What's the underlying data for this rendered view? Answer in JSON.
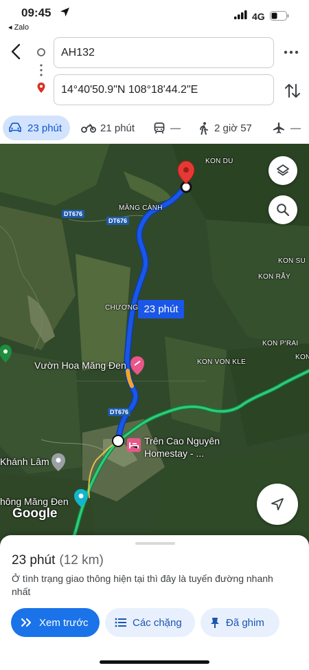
{
  "status_bar": {
    "time": "09:45",
    "back_app": "◂ Zalo",
    "network": "4G"
  },
  "directions": {
    "origin": "AH132",
    "destination": "14°40'50.9\"N 108°18'44.2\"E"
  },
  "modes": [
    {
      "name": "car",
      "label": "23 phút",
      "selected": true
    },
    {
      "name": "motorbike",
      "label": "21 phút",
      "selected": false
    },
    {
      "name": "transit",
      "label": "—",
      "selected": false
    },
    {
      "name": "walk",
      "label": "2 giờ 57",
      "selected": false
    },
    {
      "name": "flight",
      "label": "—",
      "selected": false
    }
  ],
  "map": {
    "places": [
      {
        "label": "KON DU"
      },
      {
        "label": "MĂNG CÀNH"
      },
      {
        "label": "KON SU"
      },
      {
        "label": "KON RẪY"
      },
      {
        "label": "CHƯƠNG"
      },
      {
        "label": "KON P'RAI"
      },
      {
        "label": "KON VON KLE"
      },
      {
        "label": "KON"
      }
    ],
    "road_tags": [
      "DT676",
      "DT676",
      "DT676"
    ],
    "pois": {
      "flower_garden": "Vườn Hoa Măng Đen",
      "homestay_line1": "Trên Cao Nguyên",
      "homestay_line2": "Homestay - ...",
      "khanh_lam": "Khánh Lâm",
      "mang_den": "hông Măng Đen"
    },
    "route_time": "23 phút",
    "logo": "Google",
    "route_color": "#1a56e8",
    "traffic_color": "#f5a623"
  },
  "summary": {
    "time": "23 phút",
    "distance": "(12 km)",
    "description": "Ở tình trạng giao thông hiện tại thì đây là tuyến đường nhanh nhất"
  },
  "actions": {
    "preview": "Xem trước",
    "steps": "Các chặng",
    "pinned": "Đã ghim"
  }
}
